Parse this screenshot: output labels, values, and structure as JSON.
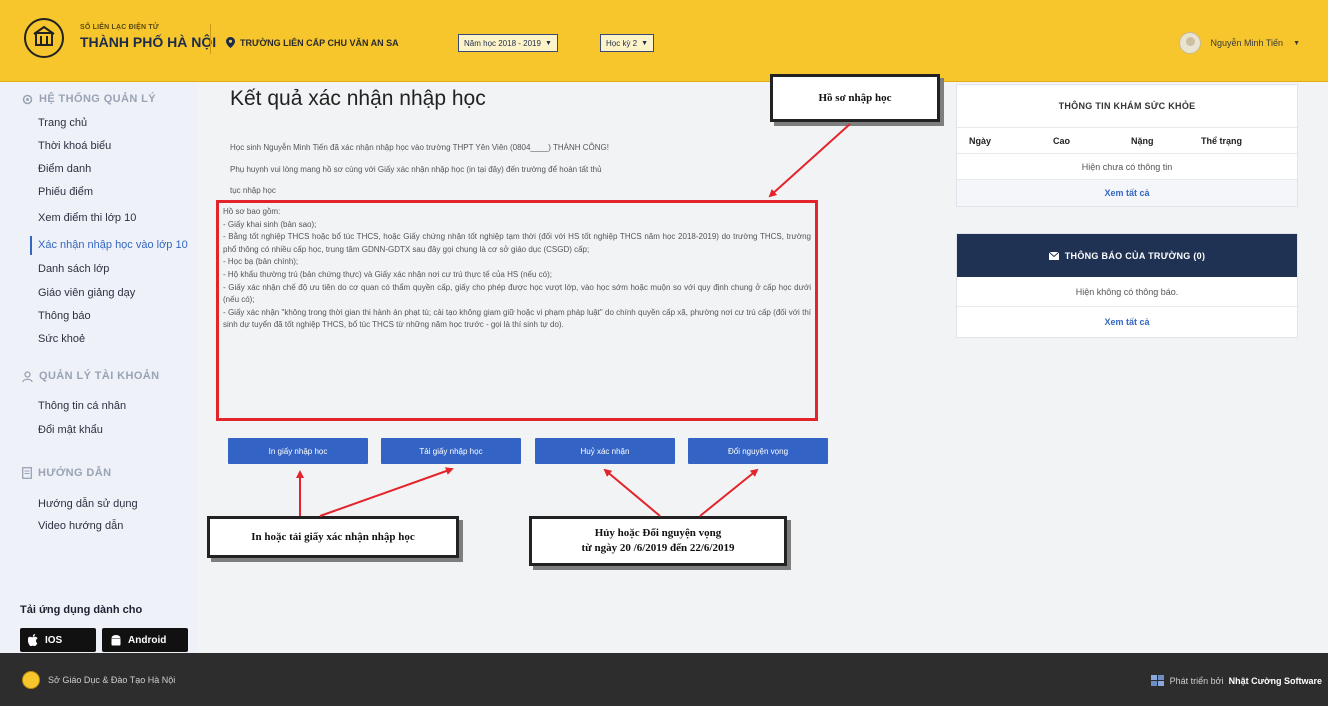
{
  "header": {
    "logo_small": "SỔ LIÊN LẠC ĐIỆN TỬ",
    "logo_big": "THÀNH PHỐ HÀ NỘI",
    "school": "TRƯỜNG LIÊN CẤP CHU VĂN AN SA",
    "year_select": "Năm học 2018 - 2019",
    "term_select": "Học kỳ 2",
    "user_name": "Nguyễn Minh Tiến",
    "brand_color": "#f6c62c"
  },
  "sidebar": {
    "section_system": "HỆ THỐNG QUẢN LÝ",
    "system_items": [
      "Trang chủ",
      "Thời khoá biểu",
      "Điểm danh",
      "Phiếu điểm",
      "Xem điểm thi lớp 10",
      "Xác nhận nhập học vào lớp 10",
      "Danh sách lớp",
      "Giáo viên giảng dạy",
      "Thông báo",
      "Sức khoẻ"
    ],
    "active_item": "Xác nhận nhập học vào lớp 10",
    "section_account": "QUẢN LÝ TÀI KHOẢN",
    "account_items": [
      "Thông tin cá nhân",
      "Đổi mật khẩu"
    ],
    "section_guide": "HƯỚNG DẪN",
    "guide_items": [
      "Hướng dẫn sử dụng",
      "Video hướng dẫn"
    ],
    "apps_title": "Tải ứng dụng dành cho",
    "app_ios": "IOS",
    "app_android": "Android"
  },
  "main": {
    "title": "Kết quả xác nhận nhập học",
    "line1": "Học sinh Nguyễn Minh Tiến đã xác nhận nhập học vào trường THPT Yên Viên (0804____) THÀNH CÔNG!",
    "line2": "Phụ huynh vui lòng mang hồ sơ cùng với Giấy xác nhận nhập học (in tại đây) đến trường để hoàn tất thủ",
    "line3": "tục nhập học",
    "docs_title": "Hồ sơ bao gồm:",
    "docs": [
      "- Giấy khai sinh (bản sao);",
      "- Bằng tốt nghiệp THCS hoặc bổ túc THCS, hoặc Giấy chứng nhận tốt nghiệp tạm thời (đối với HS tốt nghiệp THCS năm học 2018-2019) do trường THCS, trường phổ thông có nhiều cấp học, trung tâm GDNN-GDTX sau đây gọi chung là cơ sở giáo dục (CSGD) cấp;",
      "- Học bạ (bản chính);",
      "- Hộ khẩu thường trú (bản chứng thực) và Giấy xác nhận nơi cư trú thực tế của HS (nếu có);",
      "- Giấy xác nhận chế độ ưu tiên do cơ quan có thẩm quyền cấp, giấy cho phép được học vượt lớp, vào học sớm hoặc muộn so với quy định chung ở cấp học dưới (nếu có);",
      "- Giấy xác nhận \"không trong thời gian thi hành án phạt tù; cải tạo không giam giữ hoặc vi phạm pháp luật\" do chính quyền cấp xã, phường nơi cư trú cấp (đối với thí sinh dự tuyển đã tốt nghiệp THCS, bổ túc THCS từ những năm học trước - gọi là thí sinh tự do)."
    ],
    "buttons": {
      "print": "In giấy nhập học",
      "download": "Tải giấy nhập học",
      "cancel": "Huỷ xác nhận",
      "change": "Đổi nguyện vọng"
    }
  },
  "annotations": {
    "records": "Hồ sơ nhập học",
    "print_or_download": "In hoặc tải giấy xác nhận nhập học",
    "cancel_line1": "Hủy hoặc Đổi nguyện vọng",
    "cancel_line2": "từ ngày 20 /6/2019 đến 22/6/2019"
  },
  "health": {
    "title": "THÔNG TIN KHÁM SỨC KHỎE",
    "columns": [
      "Ngày",
      "Cao",
      "Nặng",
      "Thể trạng"
    ],
    "empty": "Hiện chưa có thông tin",
    "see_all": "Xem tất cả"
  },
  "notices": {
    "title": "THÔNG BÁO CỦA TRƯỜNG (0)",
    "empty": "Hiện không có thông báo.",
    "see_all": "Xem tất cả"
  },
  "footer": {
    "left": "Sở Giáo Dục & Đào Tạo Hà Nội",
    "dev_prefix": "Phát triển bởi",
    "dev_name": "Nhật Cường Software"
  }
}
